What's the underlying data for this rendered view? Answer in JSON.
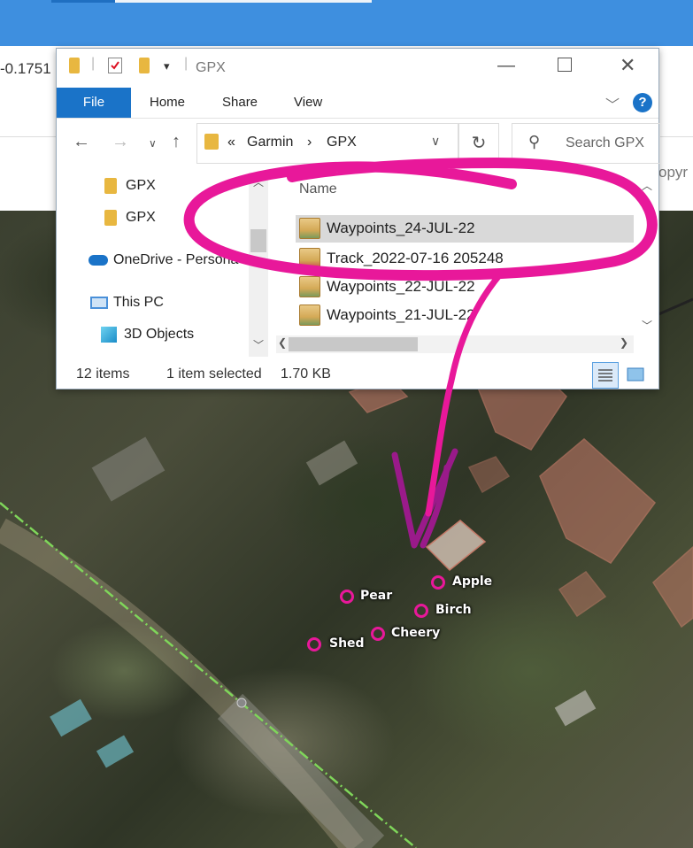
{
  "browser": {
    "coordinate_fragment": "-0.1751",
    "copyright_fragment": "opyr"
  },
  "explorer": {
    "title": "GPX",
    "ribbon_tabs": [
      "File",
      "Home",
      "Share",
      "View"
    ],
    "help_label": "?",
    "address": {
      "overflow": "«",
      "segments": [
        "Garmin",
        "GPX"
      ],
      "separator": "›"
    },
    "search_placeholder": "Search GPX",
    "nav_items": [
      "GPX",
      "GPX",
      "OneDrive - Persona",
      "This PC",
      "3D Objects"
    ],
    "column_header": "Name",
    "files": [
      {
        "name": "Waypoints_24-JUL-22",
        "type": "waypoints",
        "selected": true
      },
      {
        "name": "Track_2022-07-16 205248",
        "type": "track",
        "selected": false
      },
      {
        "name": "Waypoints_22-JUL-22",
        "type": "waypoints",
        "selected": false
      },
      {
        "name": "Waypoints_21-JUL-22",
        "type": "waypoints",
        "selected": false
      }
    ],
    "status": {
      "item_count": "12 items",
      "selection": "1 item selected",
      "size": "1.70 KB"
    }
  },
  "map": {
    "waypoints": [
      "Apple",
      "Pear",
      "Birch",
      "Cheery",
      "Shed"
    ],
    "annotation_color": "#e8189a",
    "track_color": "#7fd65a"
  }
}
